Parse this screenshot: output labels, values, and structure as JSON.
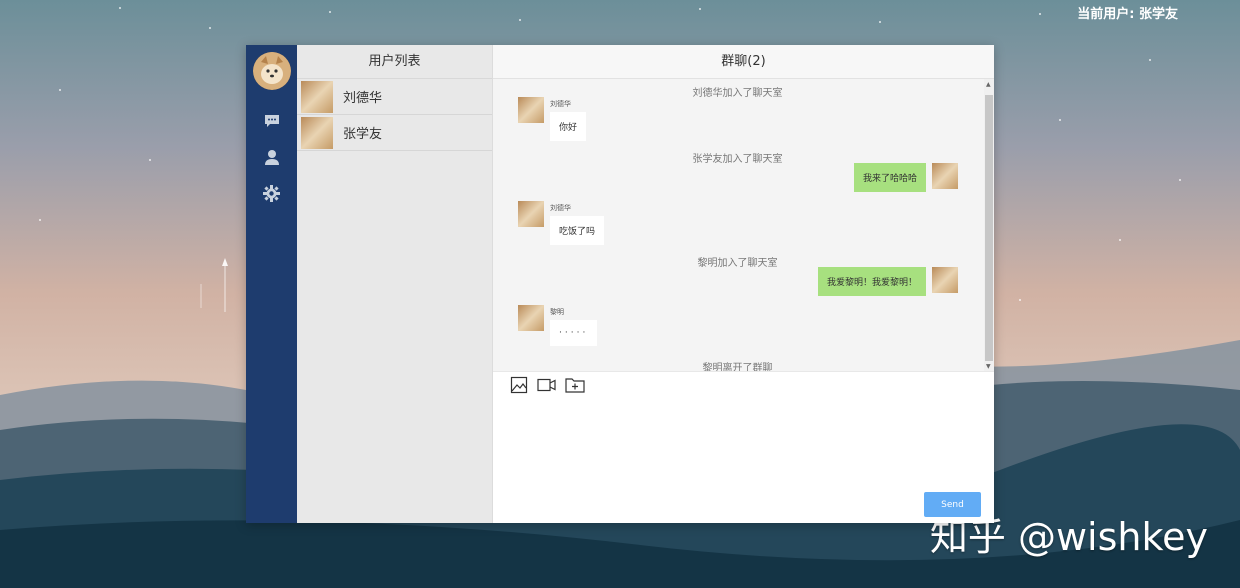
{
  "header": {
    "current_user": "当前用户: 张学友"
  },
  "watermark": "知乎 @wishkey",
  "sidebar": {
    "icons": [
      "chat-icon",
      "user-icon",
      "settings-icon"
    ],
    "accent": "#1e3c6e"
  },
  "user_list": {
    "title": "用户列表",
    "users": [
      {
        "name": "刘德华"
      },
      {
        "name": "张学友"
      }
    ]
  },
  "chat": {
    "title": "群聊(2)",
    "messages": [
      {
        "type": "system",
        "text": "刘德华加入了聊天室"
      },
      {
        "type": "left",
        "sender": "刘德华",
        "text": "你好"
      },
      {
        "type": "system",
        "text": "张学友加入了聊天室"
      },
      {
        "type": "right",
        "text": "我来了哈哈哈"
      },
      {
        "type": "left",
        "sender": "刘德华",
        "text": "吃饭了吗"
      },
      {
        "type": "system",
        "text": "黎明加入了聊天室"
      },
      {
        "type": "right",
        "text": "我爱黎明！我爱黎明！"
      },
      {
        "type": "left",
        "sender": "黎明",
        "text": "·····"
      },
      {
        "type": "system",
        "text": "黎明离开了群聊"
      }
    ],
    "toolbar": [
      "image-icon",
      "video-icon",
      "folder-add-icon"
    ],
    "send_label": "Send",
    "bubble_self_color": "#a7e07f",
    "send_color": "#62acf5"
  }
}
